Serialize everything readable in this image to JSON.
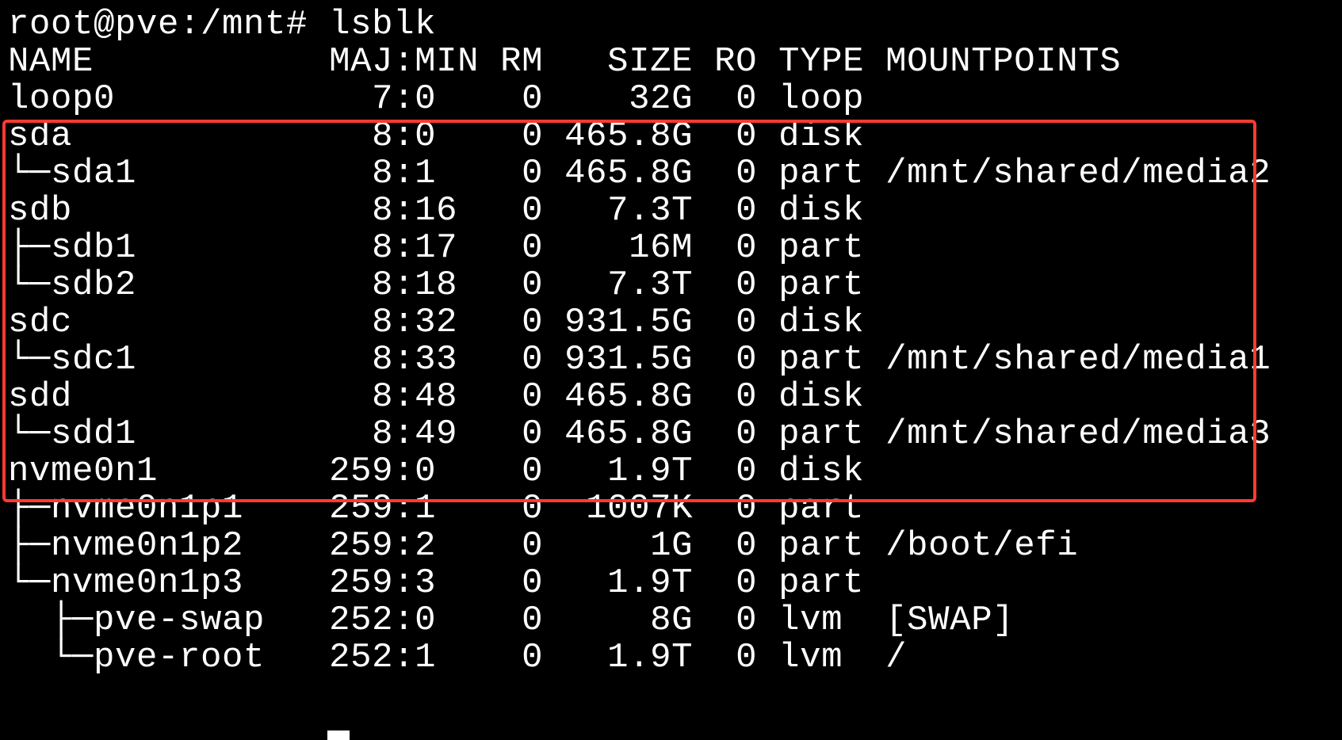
{
  "terminal": {
    "prompt_line": "root@pve:/mnt# lsblk",
    "header": "NAME           MAJ:MIN RM   SIZE RO TYPE MOUNTPOINTS",
    "rows": [
      "loop0            7:0    0    32G  0 loop",
      "sda              8:0    0 465.8G  0 disk",
      "└─sda1           8:1    0 465.8G  0 part /mnt/shared/media2",
      "sdb              8:16   0   7.3T  0 disk",
      "├─sdb1           8:17   0    16M  0 part",
      "└─sdb2           8:18   0   7.3T  0 part",
      "sdc              8:32   0 931.5G  0 disk",
      "└─sdc1           8:33   0 931.5G  0 part /mnt/shared/media1",
      "sdd              8:48   0 465.8G  0 disk",
      "└─sdd1           8:49   0 465.8G  0 part /mnt/shared/media3",
      "nvme0n1        259:0    0   1.9T  0 disk",
      "├─nvme0n1p1    259:1    0  1007K  0 part",
      "├─nvme0n1p2    259:2    0     1G  0 part /boot/efi",
      "└─nvme0n1p3    259:3    0   1.9T  0 part",
      "  ├─pve-swap   252:0    0     8G  0 lvm  [SWAP]",
      "  └─pve-root   252:1    0   1.9T  0 lvm  /"
    ]
  },
  "colors": {
    "background": "#000000",
    "text": "#ffffff",
    "highlight": "#ff3b30"
  }
}
